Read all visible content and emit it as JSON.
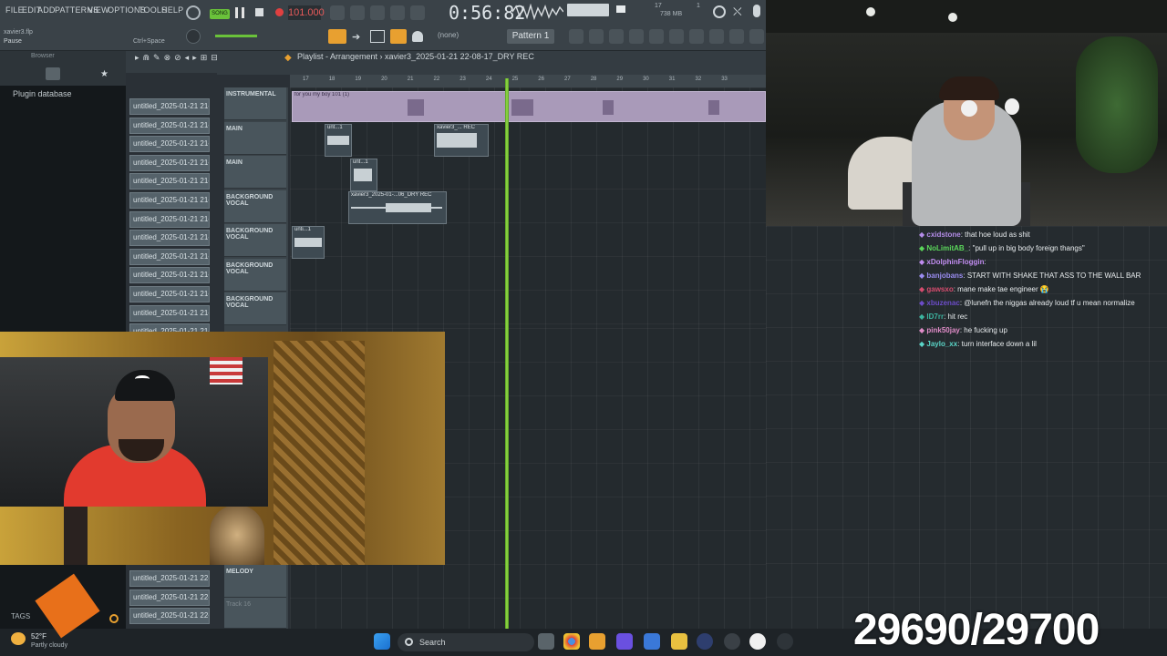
{
  "menu": [
    "FILE",
    "EDIT",
    "ADD",
    "PATTERNS",
    "VIEW",
    "OPTIONS",
    "TOOLS",
    "HELP"
  ],
  "project_file": "xavier3.flp",
  "hint_left": "Pause",
  "hint_right": "Ctrl+Space",
  "song_mode": "SONG",
  "tempo": "101.000",
  "time": "0:56:82",
  "cpu": "17",
  "memory": "738 MB",
  "memory_sub": "1",
  "channel_select": "(none)",
  "pattern": "Pattern 1",
  "playlist_title": "Playlist - Arrangement",
  "playlist_breadcrumb": "xavier3_2025-01-21 22-08-17_DRY REC",
  "browser_label": "Browser",
  "plugin_db": "Plugin database",
  "tags": "TAGS",
  "ruler": [
    "17",
    "18",
    "19",
    "20",
    "21",
    "22",
    "23",
    "24",
    "25",
    "26",
    "27",
    "28",
    "29",
    "30",
    "31",
    "32",
    "33"
  ],
  "channels_top": [
    "untitled_2025-01-21 21-",
    "untitled_2025-01-21 21-",
    "untitled_2025-01-21 21-",
    "untitled_2025-01-21 21-",
    "untitled_2025-01-21 21-",
    "untitled_2025-01-21 21-",
    "untitled_2025-01-21 21-",
    "untitled_2025-01-21 21-",
    "untitled_2025-01-21 21-",
    "untitled_2025-01-21 21-",
    "untitled_2025-01-21 21-",
    "untitled_2025-01-21 21-",
    "untitled_2025-01-21 21-"
  ],
  "channels_bottom": [
    "untitled_2025-01-21 22-",
    "untitled_2025-01-21 22-",
    "untitled_2025-01-21 22-"
  ],
  "tracks": [
    "INSTRUMENTAL",
    "MAIN",
    "MAIN",
    "BACKGROUND VOCAL",
    "BACKGROUND VOCAL",
    "BACKGROUND VOCAL",
    "BACKGROUND VOCAL"
  ],
  "track_melody": "MELODY",
  "track_16": "Track 16",
  "clips": {
    "instrumental": "for you my boy 101 (1)",
    "c1": "unt...1",
    "c2": "xavier3_... REC",
    "c3": "unt...1",
    "c4": "xavier3_2025-01-...06_DRY REC",
    "c5": "unti...1"
  },
  "chat": [
    {
      "user": "cxidstone",
      "color": "#b48ce8",
      "msg": "that hoe loud as shit"
    },
    {
      "user": "NoLimitAB_",
      "color": "#5ad65a",
      "msg": "\"pull up in big body foreign thangs\""
    },
    {
      "user": "xDolphinFloggin",
      "color": "#c08cf0",
      "msg": ""
    },
    {
      "user": "banjobans",
      "color": "#9a8cf0",
      "msg": "START WITH SHAKE THAT ASS TO THE WALL BAR"
    },
    {
      "user": "gawsxo",
      "color": "#d64c6e",
      "msg": "mane make tae engineer 😭"
    },
    {
      "user": "xbuzenac",
      "color": "#6c4cc8",
      "msg": "@lunefn the niggas already loud tf u mean normalize"
    },
    {
      "user": "lD7rr",
      "color": "#3cb4a0",
      "msg": "hit rec"
    },
    {
      "user": "pink50jay",
      "color": "#e08cc8",
      "msg": "he fucking up"
    },
    {
      "user": "Jaylo_xx",
      "color": "#5ad6c8",
      "msg": "turn interface down a lil"
    }
  ],
  "weather_temp": "52°F",
  "weather_desc": "Partly cloudy",
  "taskbar_search": "Search",
  "counter": "29690/29700"
}
